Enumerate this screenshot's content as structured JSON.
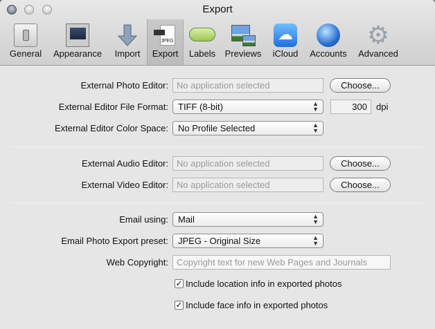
{
  "window": {
    "title": "Export"
  },
  "toolbar": [
    {
      "label": "General",
      "icon": "switch-icon"
    },
    {
      "label": "Appearance",
      "icon": "display-icon"
    },
    {
      "label": "Import",
      "icon": "arrow-down-icon"
    },
    {
      "label": "Export",
      "icon": "jpeg-export-icon",
      "icon_text": "JPEG"
    },
    {
      "label": "Labels",
      "icon": "label-pill-icon"
    },
    {
      "label": "Previews",
      "icon": "photo-previews-icon"
    },
    {
      "label": "iCloud",
      "icon": "cloud-icon"
    },
    {
      "label": "Accounts",
      "icon": "globe-icon"
    },
    {
      "label": "Advanced",
      "icon": "gear-icon"
    }
  ],
  "form": {
    "photo_editor": {
      "label": "External Photo Editor:",
      "placeholder": "No application selected",
      "button": "Choose..."
    },
    "file_format": {
      "label": "External Editor File Format:",
      "value": "TIFF (8-bit)",
      "dpi": "300",
      "dpi_unit": "dpi"
    },
    "color_space": {
      "label": "External Editor Color Space:",
      "value": "No Profile Selected"
    },
    "audio_editor": {
      "label": "External Audio Editor:",
      "placeholder": "No application selected",
      "button": "Choose..."
    },
    "video_editor": {
      "label": "External Video Editor:",
      "placeholder": "No application selected",
      "button": "Choose..."
    },
    "email_using": {
      "label": "Email using:",
      "value": "Mail"
    },
    "email_preset": {
      "label": "Email Photo Export preset:",
      "value": "JPEG - Original Size"
    },
    "web_copyright": {
      "label": "Web Copyright:",
      "placeholder": "Copyright text for new Web Pages and Journals"
    },
    "include_location": {
      "label": "Include location info in exported photos",
      "checked": true
    },
    "include_face": {
      "label": "Include face info in exported photos",
      "checked": true
    }
  },
  "check_mark": "✓"
}
